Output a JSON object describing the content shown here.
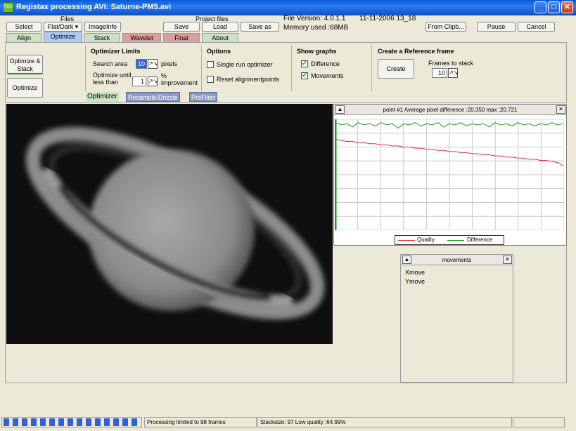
{
  "window": {
    "title": "Registax processing AVI: Saturne-PM5.avi",
    "app_icon_text": "RGX"
  },
  "toolbar": {
    "files_label": "Files",
    "project_files_label": "Project files",
    "select": "Select",
    "flatdark": "Flat/Dark ▾",
    "imageinfo": "ImageInfo",
    "save": "Save",
    "load": "Load",
    "save_as": "Save as",
    "file_version": "File Version: 4.0.1.1",
    "datetime": "11-11-2006 13_18",
    "memory": "Memory used :68MB",
    "from_clip": "From Clipb...",
    "pause": "Pause",
    "cancel": "Cancel"
  },
  "tabs": [
    "Align",
    "Optimize",
    "Stack",
    "Wavelet",
    "Final",
    "About"
  ],
  "optimize_panel": {
    "optimize_stack": "Optimize & Stack",
    "optimize": "Optimize",
    "limits_title": "Optimizer Limits",
    "search_area": "Search area",
    "search_value": "10",
    "pixels": "pixels",
    "until_label": "Optimize until less than",
    "until_value": "1",
    "improvement": "% improvement",
    "options_title": "Options",
    "single_run": "Single run optimizer",
    "reset_align": "Reset alignmentpoints",
    "graphs_title": "Show graphs",
    "difference": "Difference",
    "movements": "Movements",
    "ref_title": "Create a Reference frame",
    "create": "Create",
    "frames_to_stack": "Frames to stack",
    "frames_value": "10"
  },
  "subtabs": [
    "Optimizer",
    "Resample/Drizzle",
    "PreFilter"
  ],
  "graph": {
    "title": "point #1  Average pixel difference :20.350 max :20.721",
    "legend_quality": "Quality",
    "legend_difference": "Difference",
    "quality_color": "#e03030",
    "difference_color": "#1a9a1a",
    "x": [
      0,
      1,
      2,
      3,
      4,
      5,
      6,
      7,
      8,
      9,
      10,
      11,
      12,
      13,
      14,
      15,
      16,
      17,
      18,
      19,
      20,
      21,
      22,
      23,
      24,
      25,
      26,
      27,
      28,
      29,
      30,
      31,
      32,
      33,
      34,
      35,
      36,
      37,
      38,
      39,
      40
    ],
    "quality": [
      0.82,
      0.81,
      0.8,
      0.8,
      0.79,
      0.79,
      0.78,
      0.78,
      0.77,
      0.77,
      0.76,
      0.76,
      0.75,
      0.75,
      0.74,
      0.74,
      0.73,
      0.73,
      0.72,
      0.72,
      0.71,
      0.71,
      0.7,
      0.7,
      0.69,
      0.69,
      0.68,
      0.68,
      0.67,
      0.67,
      0.66,
      0.66,
      0.65,
      0.65,
      0.64,
      0.64,
      0.63,
      0.63,
      0.62,
      0.61,
      0.58
    ],
    "difference": [
      0.97,
      0.95,
      0.96,
      0.93,
      0.97,
      0.95,
      0.96,
      0.94,
      0.97,
      0.95,
      0.96,
      0.92,
      0.96,
      0.95,
      0.97,
      0.94,
      0.96,
      0.95,
      0.97,
      0.93,
      0.96,
      0.95,
      0.97,
      0.94,
      0.96,
      0.95,
      0.96,
      0.93,
      0.97,
      0.95,
      0.96,
      0.94,
      0.97,
      0.95,
      0.96,
      0.94,
      0.96,
      0.95,
      0.97,
      0.95,
      0.96
    ]
  },
  "movements": {
    "title": "movements",
    "xmove": "Xmove",
    "ymove": "Ymove"
  },
  "status": {
    "progress_blocks": 15,
    "processing": "Processing limited to 98 frames",
    "stacksize": "Stacksize: 97 Low quality :64.99%"
  }
}
